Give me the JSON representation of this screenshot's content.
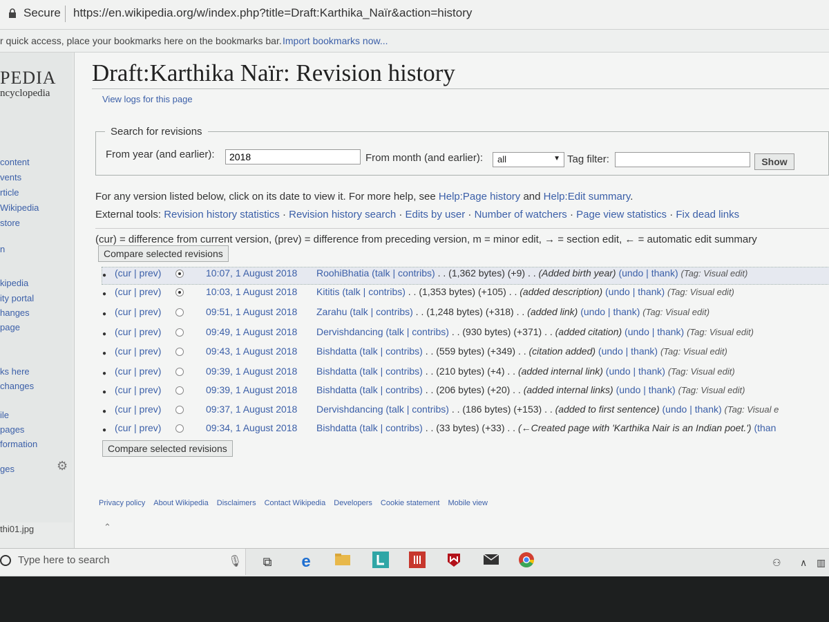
{
  "browser": {
    "secure_label": "Secure",
    "url": "https://en.wikipedia.org/w/index.php?title=Draft:Karthika_Naïr&action=history",
    "bookmarks_text": "r quick access, place your bookmarks here on the bookmarks bar.",
    "bookmarks_link": "Import bookmarks now..."
  },
  "sidebar": {
    "logo_top": "PEDIA",
    "logo_sub": "ncyclopedia",
    "items": [
      "content",
      "vents",
      "rticle",
      "Wikipedia",
      "store",
      "n",
      "kipedia",
      "ity portal",
      "hanges",
      "page",
      "ks here",
      "changes",
      "ile",
      "pages",
      "formation",
      "ges"
    ]
  },
  "page": {
    "title": "Draft:Karthika Naïr: Revision history",
    "view_logs": "View logs for this page"
  },
  "search": {
    "legend": "Search for revisions",
    "year_label": "From year (and earlier):",
    "year_value": "2018",
    "month_label": "From month (and earlier):",
    "month_value": "all",
    "tag_label": "Tag filter:",
    "tag_value": "",
    "show_button": "Show"
  },
  "help": {
    "prefix": "For any version listed below, click on its date to view it. For more help, see ",
    "link1": "Help:Page history",
    "and": " and ",
    "link2": "Help:Edit summary",
    "suffix": "."
  },
  "external_tools": {
    "label": "External tools: ",
    "links": [
      "Revision history statistics",
      "Revision history search",
      "Edits by user",
      "Number of watchers",
      "Page view statistics",
      "Fix dead links"
    ]
  },
  "legend_line": "(cur) = difference from current version, (prev) = difference from preceding version,  m = minor edit, → = section edit, ← = automatic edit summary",
  "compare_button": "Compare selected revisions",
  "revisions": [
    {
      "curprev": "(cur | prev)",
      "date": "10:07, 1 August 2018",
      "user": "RoohiBhatia",
      "links": "(talk | contribs)",
      "bytes": "(1,362 bytes) (+9)",
      "summary": "(Added birth year)",
      "actions": "(undo | thank)",
      "tag": "(Tag: Visual edit)"
    },
    {
      "curprev": "(cur | prev)",
      "date": "10:03, 1 August 2018",
      "user": "Kititis",
      "links": "(talk | contribs)",
      "bytes": "(1,353 bytes) (+105)",
      "summary": "(added description)",
      "actions": "(undo | thank)",
      "tag": "(Tag: Visual edit)"
    },
    {
      "curprev": "(cur | prev)",
      "date": "09:51, 1 August 2018",
      "user": "Zarahu",
      "links": "(talk | contribs)",
      "bytes": "(1,248 bytes) (+318)",
      "summary": "(added link)",
      "actions": "(undo | thank)",
      "tag": "(Tag: Visual edit)"
    },
    {
      "curprev": "(cur | prev)",
      "date": "09:49, 1 August 2018",
      "user": "Dervishdancing",
      "links": "(talk | contribs)",
      "bytes": "(930 bytes) (+371)",
      "summary": "(added citation)",
      "actions": "(undo | thank)",
      "tag": "(Tag: Visual edit)"
    },
    {
      "curprev": "(cur | prev)",
      "date": "09:43, 1 August 2018",
      "user": "Bishdatta",
      "links": "(talk | contribs)",
      "bytes": "(559 bytes) (+349)",
      "summary": "(citation added)",
      "actions": "(undo | thank)",
      "tag": "(Tag: Visual edit)"
    },
    {
      "curprev": "(cur | prev)",
      "date": "09:39, 1 August 2018",
      "user": "Bishdatta",
      "links": "(talk | contribs)",
      "bytes": "(210 bytes) (+4)",
      "summary": "(added internal link)",
      "actions": "(undo | thank)",
      "tag": "(Tag: Visual edit)"
    },
    {
      "curprev": "(cur | prev)",
      "date": "09:39, 1 August 2018",
      "user": "Bishdatta",
      "links": "(talk | contribs)",
      "bytes": "(206 bytes) (+20)",
      "summary": "(added internal links)",
      "actions": "(undo | thank)",
      "tag": "(Tag: Visual edit)"
    },
    {
      "curprev": "(cur | prev)",
      "date": "09:37, 1 August 2018",
      "user": "Dervishdancing",
      "links": "(talk | contribs)",
      "bytes": "(186 bytes) (+153)",
      "summary": "(added to first sentence)",
      "actions": "(undo | thank)",
      "tag": "(Tag: Visual e"
    },
    {
      "curprev": "(cur | prev)",
      "date": "09:34, 1 August 2018",
      "user": "Bishdatta",
      "links": "(talk | contribs)",
      "bytes": "(33 bytes) (+33)",
      "summary": "(←Created page with 'Karthika Nair is an Indian poet.')",
      "actions": "(than",
      "tag": ""
    }
  ],
  "footer": [
    "Privacy policy",
    "About Wikipedia",
    "Disclaimers",
    "Contact Wikipedia",
    "Developers",
    "Cookie statement",
    "Mobile view"
  ],
  "download": {
    "filename": "thi01.jpg"
  },
  "taskbar": {
    "search_placeholder": "Type here to search"
  },
  "colors": {
    "link": "#3b5fa8",
    "chrome_red": "#d23f31",
    "edge_blue": "#1f6fd1",
    "folder_yellow": "#e8b84a",
    "office_red": "#c7372d",
    "mcafee_red": "#b3121a"
  }
}
